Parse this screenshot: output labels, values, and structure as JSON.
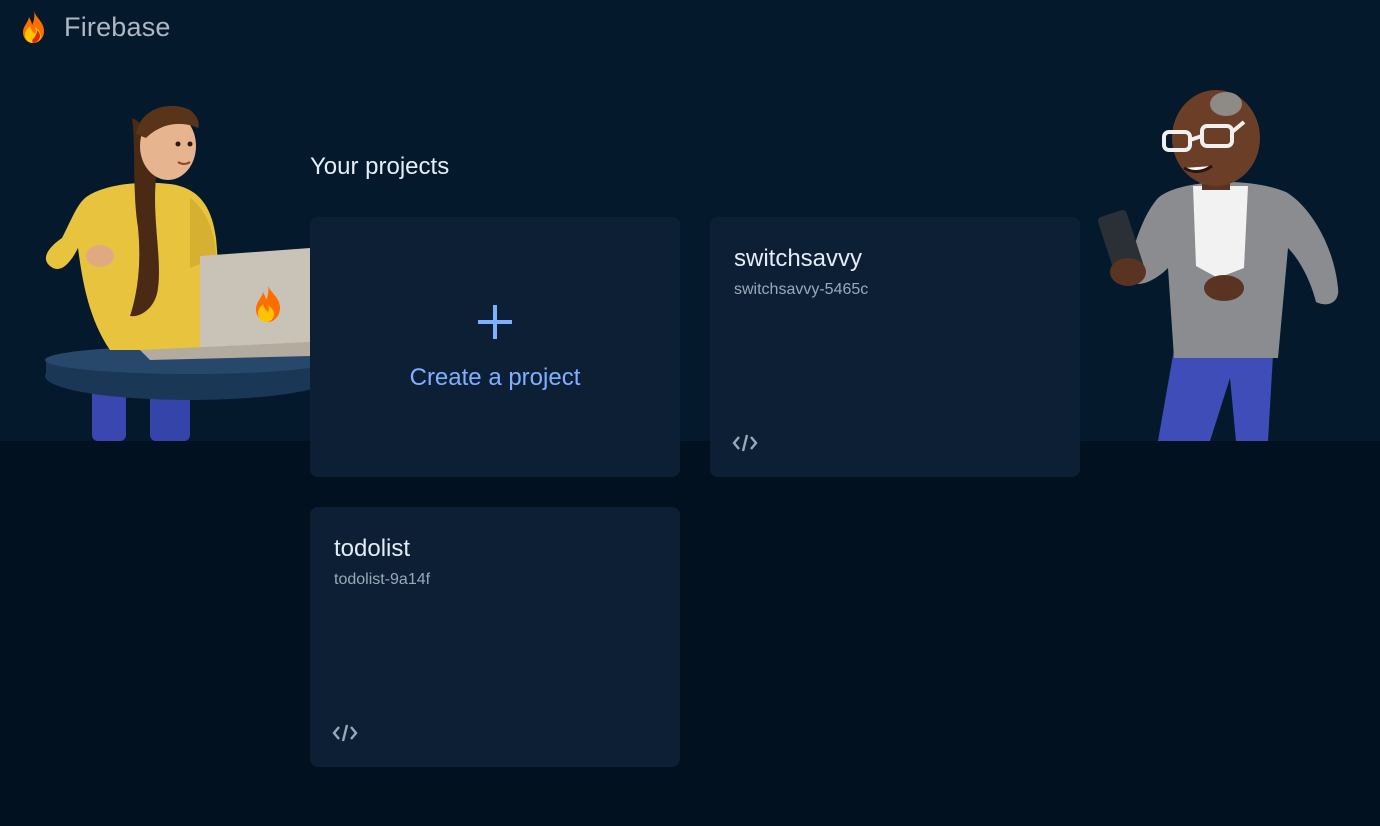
{
  "app": {
    "name": "Firebase",
    "logo_icon": "firebase-flame-icon"
  },
  "main": {
    "heading": "Your projects",
    "create_card": {
      "label": "Create a project",
      "icon": "plus-icon"
    },
    "projects": [
      {
        "name": "switchsavvy",
        "id": "switchsavvy-5465c",
        "platform_icon": "code-icon"
      },
      {
        "name": "todolist",
        "id": "todolist-9a14f",
        "platform_icon": "code-icon"
      }
    ]
  },
  "colors": {
    "background": "#02111f",
    "hero_band": "#041a2c",
    "card": "#0d1f35",
    "accent": "#7fb0ff",
    "flame_orange": "#ff6d00",
    "flame_yellow": "#ffc400",
    "flame_red": "#dd2c00"
  }
}
